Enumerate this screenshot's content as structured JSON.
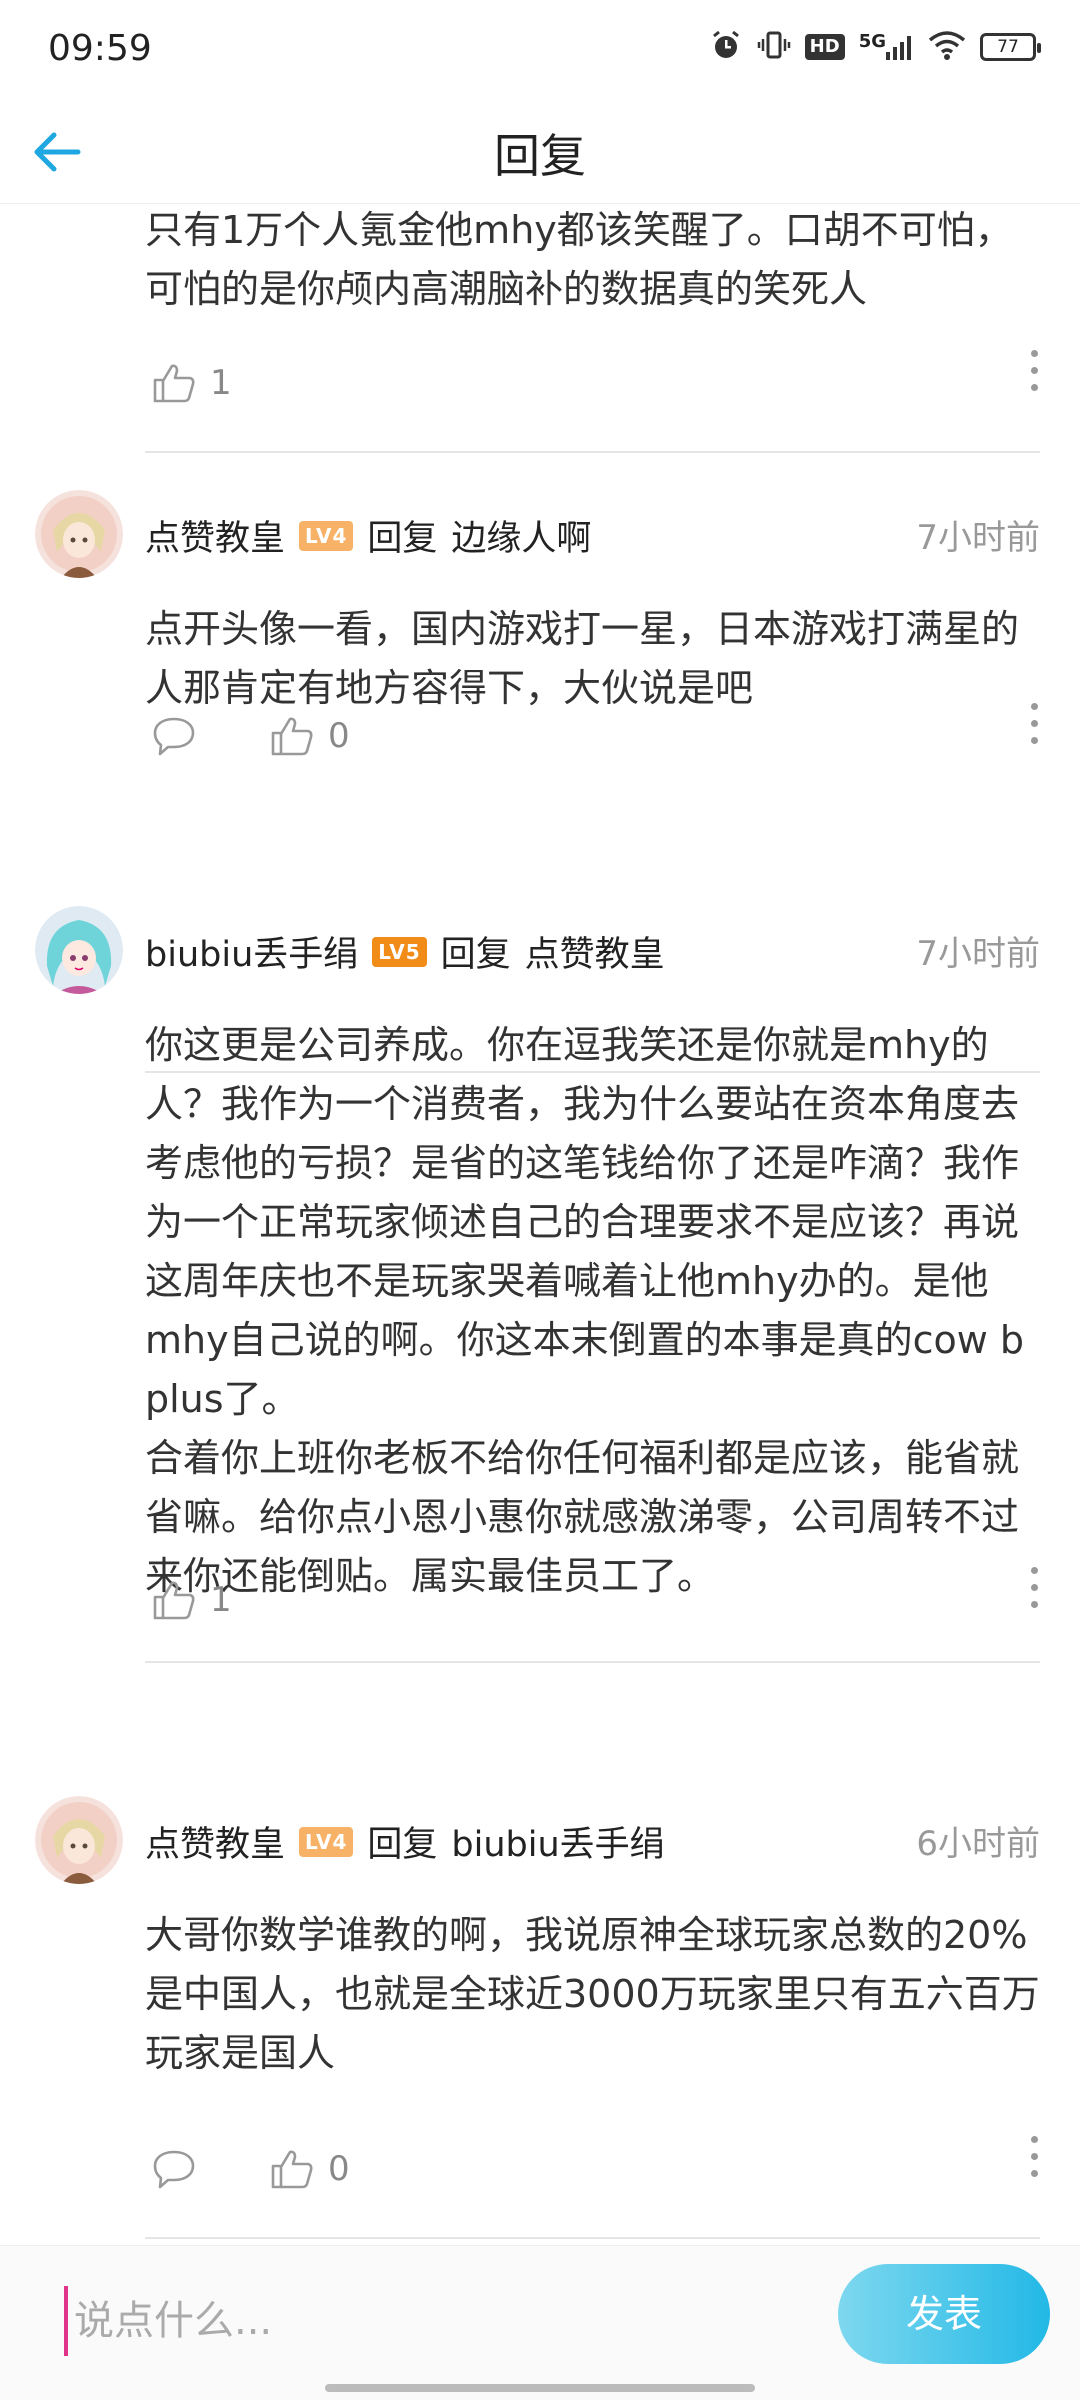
{
  "status_bar": {
    "time": "09:59",
    "network": "5G",
    "hd": "HD",
    "battery": "77"
  },
  "header": {
    "title": "回复",
    "back_icon": "back-arrow-icon"
  },
  "prev_comment": {
    "text": "只有1万个人氪金他mhy都该笑醒了。口胡不可怕，可怕的是你颅内高潮脑补的数据真的笑死人",
    "likes": "1"
  },
  "comments": [
    {
      "username": "点赞教皇",
      "level": "LV4",
      "reply_word": "回复",
      "reply_target": "边缘人啊",
      "time": "7小时前",
      "text": "点开头像一看，国内游戏打一星，日本游戏打满星的人那肯定有地方容得下，大伙说是吧",
      "likes": "0"
    },
    {
      "username": "biubiu丢手绢",
      "level": "LV5",
      "reply_word": "回复",
      "reply_target": "点赞教皇",
      "time": "7小时前",
      "text": "你这更是公司养成。你在逗我笑还是你就是mhy的人？我作为一个消费者，我为什么要站在资本角度去考虑他的亏损？是省的这笔钱给你了还是咋滴？我作为一个正常玩家倾述自己的合理要求不是应该？再说这周年庆也不是玩家哭着喊着让他mhy办的。是他mhy自己说的啊。你这本末倒置的本事是真的cow b plus了。\n合着你上班你老板不给你任何福利都是应该，能省就省嘛。给你点小恩小惠你就感激涕零，公司周转不过来你还能倒贴。属实最佳员工了。",
      "likes": "1"
    },
    {
      "username": "点赞教皇",
      "level": "LV4",
      "reply_word": "回复",
      "reply_target": "biubiu丢手绢",
      "time": "6小时前",
      "text": "大哥你数学谁教的啊，我说原神全球玩家总数的20%是中国人，也就是全球近3000万玩家里只有五六百万玩家是国人",
      "likes": "0"
    }
  ],
  "input": {
    "placeholder": "说点什么..."
  },
  "send_label": "发表",
  "colors": {
    "accent": "#22b8e6",
    "lv4": "#f7b267",
    "lv5": "#f28c18"
  }
}
